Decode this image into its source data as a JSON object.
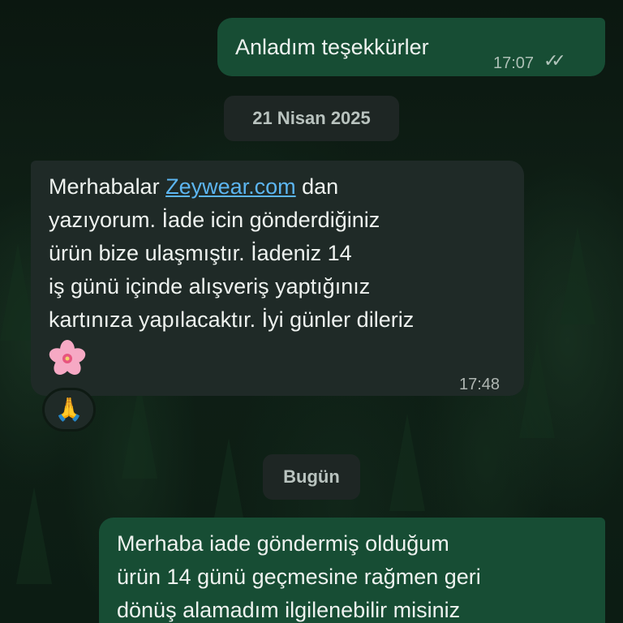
{
  "messages": [
    {
      "id": "msg1",
      "direction": "outgoing",
      "text": "Anladım teşekkürler",
      "time": "17:07",
      "status": "read-double-check"
    },
    {
      "id": "msg2",
      "direction": "incoming",
      "text_before_link": "Merhabalar ",
      "link_text": "Zeywear.com",
      "line1_after_link": " dan",
      "line2": "yazıyorum. İade icin gönderdiğiniz",
      "line3": "ürün bize ulaşmıştır. İadeniz 14",
      "line4": "iş günü içinde alışveriş yaptığınız",
      "line5": "kartınıza yapılacaktır. İyi günler dileriz",
      "emoji": "cherry-blossom",
      "time": "17:48",
      "reaction": "🙏"
    },
    {
      "id": "msg3",
      "direction": "outgoing",
      "line1": "Merhaba iade göndermiş olduğum",
      "line2": "ürün 14 günü geçmesine rağmen geri",
      "line3": "dönüş alamadım ilgilenebilir misiniz"
    }
  ],
  "date_separators": {
    "first": "21 Nisan 2025",
    "second": "Bugün"
  },
  "colors": {
    "outgoing_bubble": "#174d34",
    "incoming_bubble": "#1f2a27",
    "link": "#5cb5f0"
  }
}
